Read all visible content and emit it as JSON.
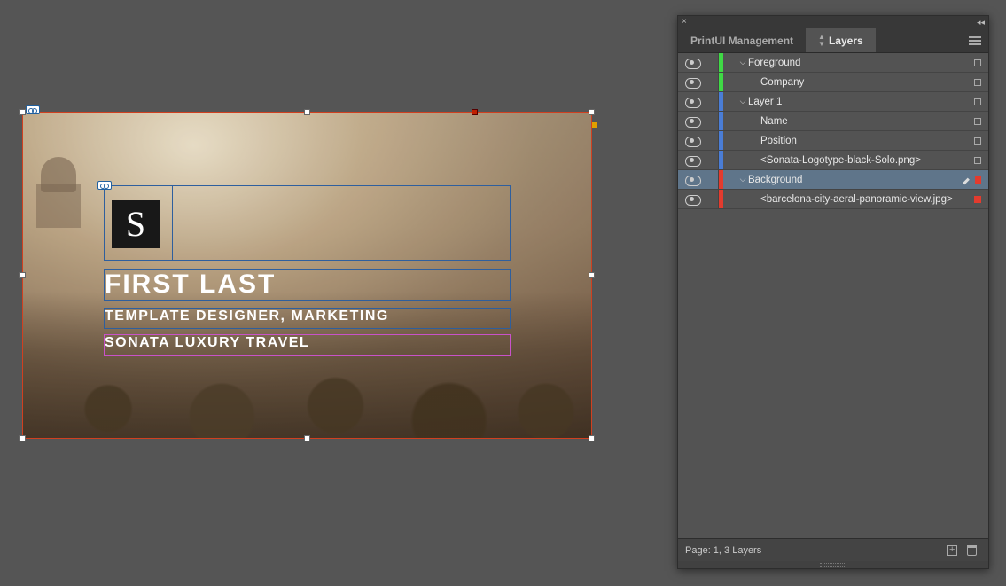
{
  "canvas": {
    "logo_letter": "S",
    "name": "FIRST LAST",
    "position": "TEMPLATE DESIGNER, MARKETING",
    "company": "SONATA LUXURY TRAVEL"
  },
  "panel": {
    "tabs": {
      "management": "PrintUI Management",
      "layers": "Layers"
    },
    "layers": [
      {
        "color": "green",
        "indent": 0,
        "disclosure": true,
        "label": "Foreground",
        "selected": false,
        "pencil": false,
        "filled": false
      },
      {
        "color": "green",
        "indent": 2,
        "disclosure": false,
        "label": "Company",
        "selected": false,
        "pencil": false,
        "filled": false
      },
      {
        "color": "blue",
        "indent": 0,
        "disclosure": true,
        "label": "Layer 1",
        "selected": false,
        "pencil": false,
        "filled": false
      },
      {
        "color": "blue",
        "indent": 2,
        "disclosure": false,
        "label": "Name",
        "selected": false,
        "pencil": false,
        "filled": false
      },
      {
        "color": "blue",
        "indent": 2,
        "disclosure": false,
        "label": "Position",
        "selected": false,
        "pencil": false,
        "filled": false
      },
      {
        "color": "blue",
        "indent": 2,
        "disclosure": false,
        "label": "<Sonata-Logotype-black-Solo.png>",
        "selected": false,
        "pencil": false,
        "filled": false
      },
      {
        "color": "red",
        "indent": 0,
        "disclosure": true,
        "label": "Background",
        "selected": true,
        "pencil": true,
        "filled": true
      },
      {
        "color": "red",
        "indent": 2,
        "disclosure": false,
        "label": "<barcelona-city-aeral-panoramic-view.jpg>",
        "selected": false,
        "pencil": false,
        "filled": true
      }
    ],
    "footer": "Page: 1, 3 Layers"
  }
}
